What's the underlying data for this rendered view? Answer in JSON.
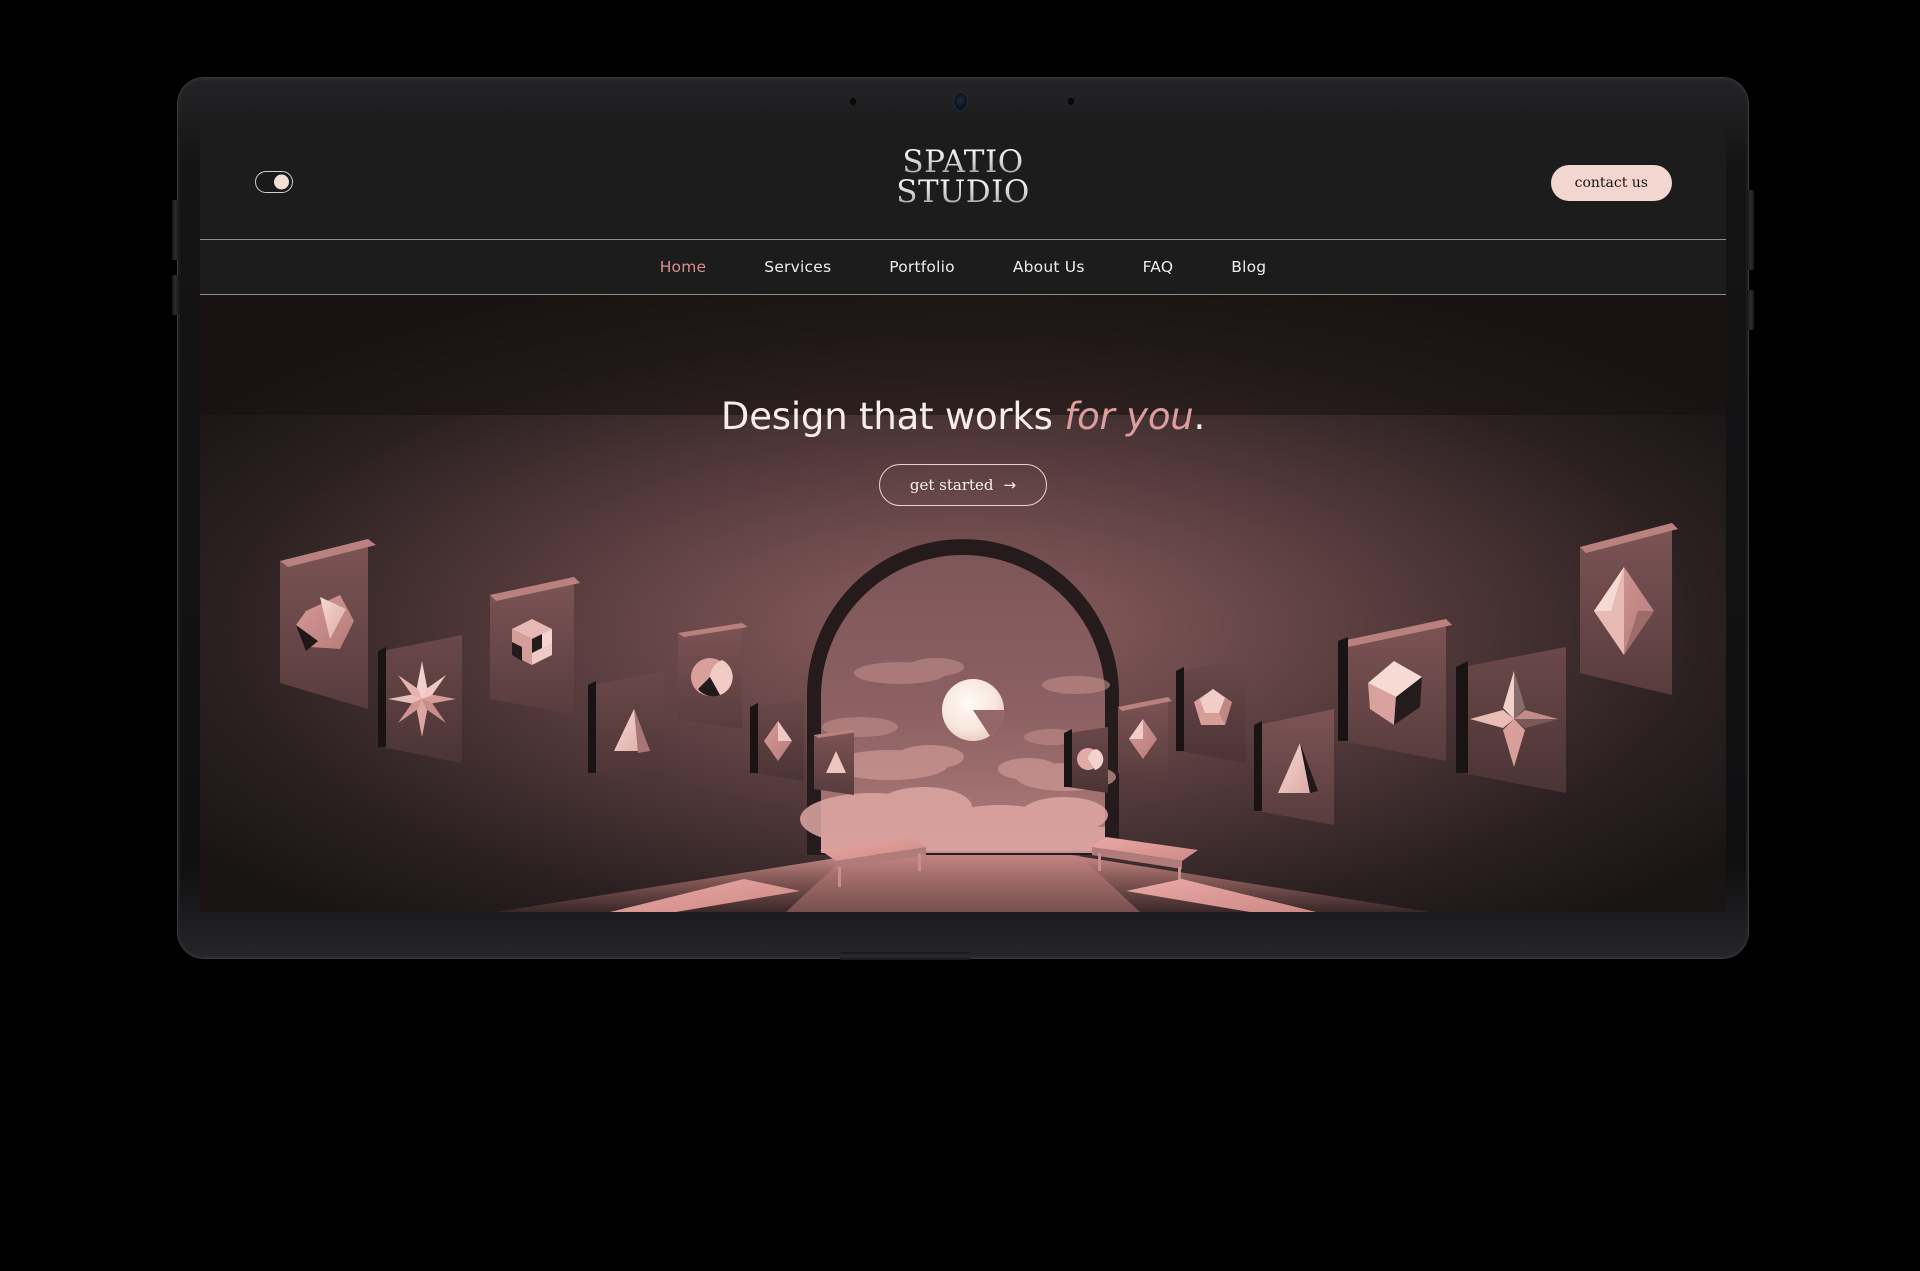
{
  "device": {
    "type": "tablet",
    "camera_icon": "camera-dot",
    "bezel_color": "#1d1d1f"
  },
  "header": {
    "theme_toggle": {
      "state": "on",
      "icon": "toggle-switch-icon"
    },
    "logo": {
      "line1": "SPATIO",
      "line2": "STUDIO"
    },
    "contact_label": "contact us"
  },
  "nav": {
    "items": [
      {
        "label": "Home",
        "active": true
      },
      {
        "label": "Services",
        "active": false
      },
      {
        "label": "Portfolio",
        "active": false
      },
      {
        "label": "About Us",
        "active": false
      },
      {
        "label": "FAQ",
        "active": false
      },
      {
        "label": "Blog",
        "active": false
      }
    ]
  },
  "hero": {
    "headline_lead": "Design that works ",
    "headline_accent": "for you",
    "headline_tail": ".",
    "cta_label": "get started",
    "cta_arrow": "→",
    "artwork": {
      "description": "dark gallery corridor with arch opening to moonlit cloudy sky, rose-pink benches and hanging panels with 3D geometric solids",
      "panels": [
        "icosahedron",
        "eight-point-star",
        "checkered-cube",
        "triangle-prism",
        "sphere",
        "small-octahedron",
        "small-pyramid",
        "sphere-small",
        "dodecahedron",
        "pyramid",
        "cube",
        "four-point-star",
        "octahedron"
      ],
      "moon": "crescent-notch-moon",
      "benches": 4
    }
  },
  "colors": {
    "accent_pink": "#dd9d9d",
    "button_pink": "#f2d6cf",
    "cream": "#f6efe9",
    "screen_bg": "#1c1c1c",
    "rose_wall": "#6d4a4c",
    "bench_pink": "#e19a9a",
    "divider": "#8d8d8d"
  }
}
